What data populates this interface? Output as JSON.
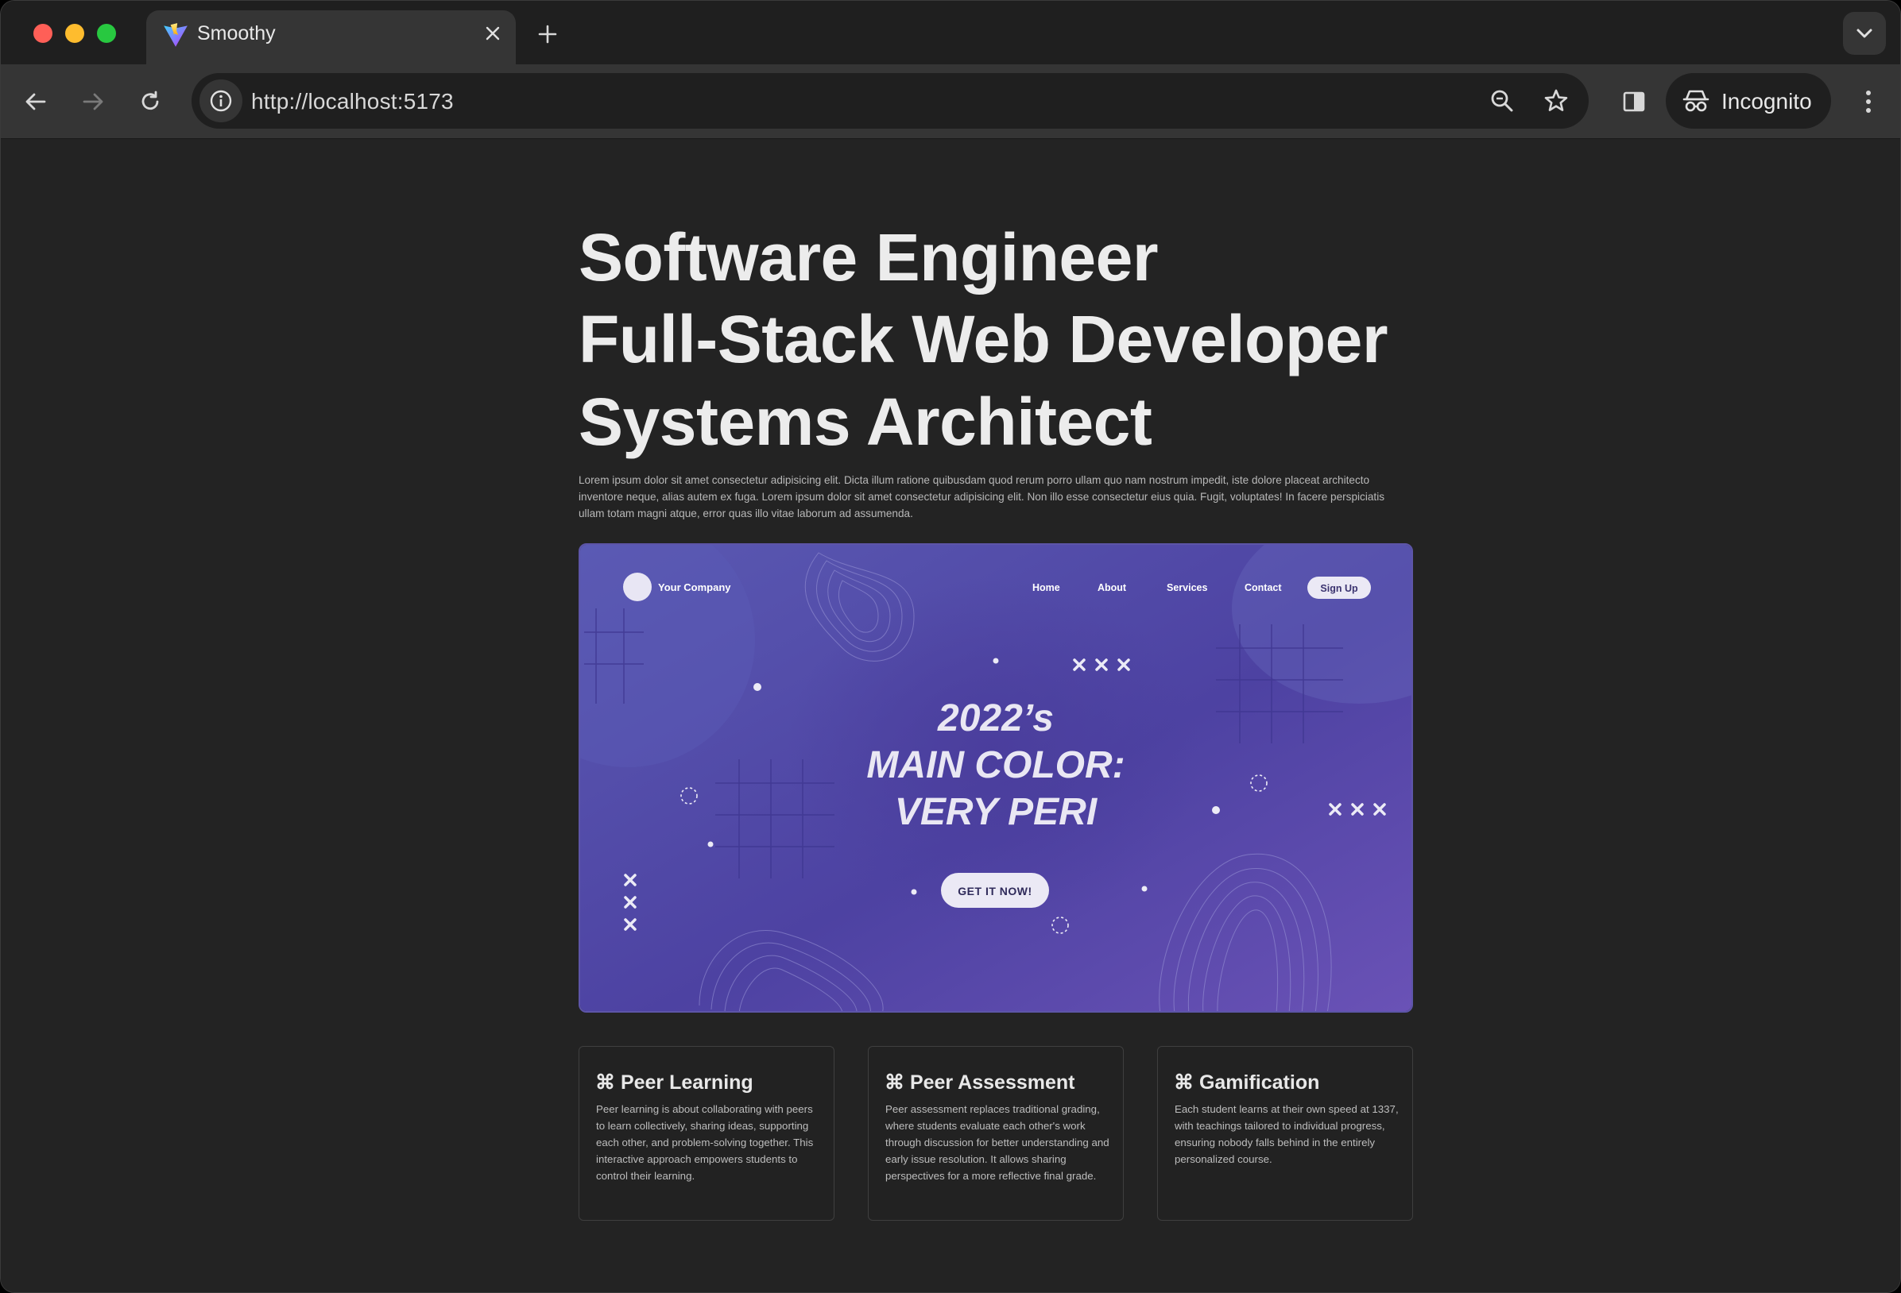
{
  "browser": {
    "tab": {
      "title": "Smoothy",
      "favicon": "vite-logo-icon"
    },
    "address": {
      "url": "http://localhost:5173"
    },
    "profile": {
      "label": "Incognito"
    }
  },
  "page": {
    "headlines": [
      "Software Engineer",
      "Full-Stack Web Developer",
      "Systems Architect"
    ],
    "intro": "Lorem ipsum dolor sit amet consectetur adipisicing elit. Dicta illum ratione quibusdam quod rerum porro ullam quo nam nostrum impedit, iste dolore placeat architecto inventore neque, alias autem ex fuga. Lorem ipsum dolor sit amet consectetur adipisicing elit. Non illo esse consectetur eius quia. Fugit, voluptates! In facere perspiciatis ullam totam magni atque, error quas illo vitae laborum ad assumenda.",
    "hero": {
      "company": "Your Company",
      "nav": [
        "Home",
        "About",
        "Services",
        "Contact"
      ],
      "signup": "Sign Up",
      "title_lines": [
        "2022’s",
        "MAIN COLOR:",
        "VERY PERI"
      ],
      "cta": "GET IT NOW!",
      "colors": {
        "background": "#5a4fb0",
        "accent": "#e8e6f4"
      }
    },
    "cards": [
      {
        "icon": "⌘",
        "title": "Peer Learning",
        "text": "Peer learning is about collaborating with peers to learn collectively, sharing ideas, supporting each other, and problem-solving together. This interactive approach empowers students to control their learning."
      },
      {
        "icon": "⌘",
        "title": "Peer Assessment",
        "text": "Peer assessment replaces traditional grading, where students evaluate each other's work through discussion for better understanding and early issue resolution. It allows sharing perspectives for a more reflective final grade."
      },
      {
        "icon": "⌘",
        "title": "Gamification",
        "text": "Each student learns at their own speed at 1337, with teachings tailored to individual progress, ensuring nobody falls behind in the entirely personalized course."
      }
    ]
  }
}
